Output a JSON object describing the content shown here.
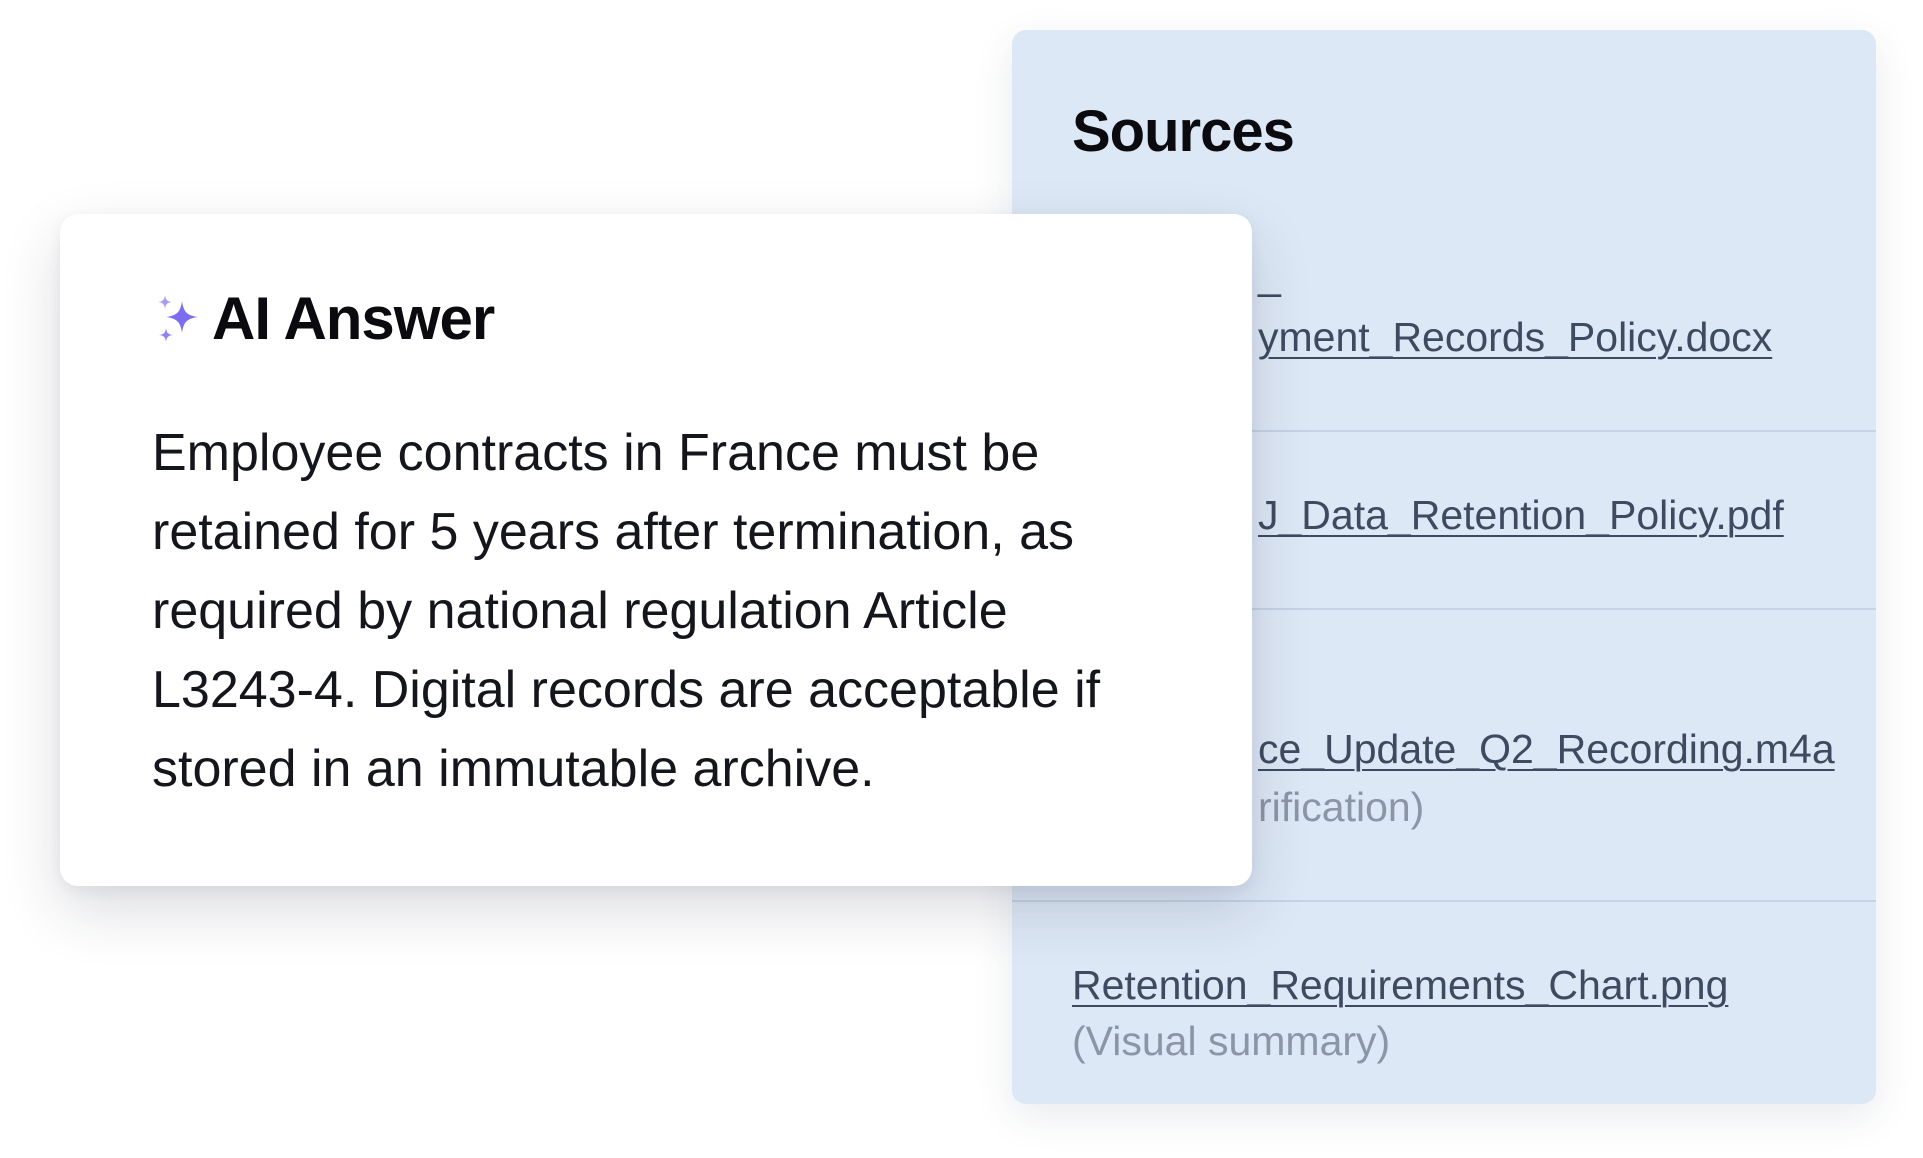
{
  "sources": {
    "title": "Sources",
    "items": [
      {
        "dash": "_",
        "link": "yment_Records_Policy.docx",
        "note": ""
      },
      {
        "link": "J_Data_Retention_Policy.pdf",
        "note": ""
      },
      {
        "link": "ce_Update_Q2_Recording.m4a",
        "note": "rification)"
      },
      {
        "link": "Retention_Requirements_Chart.png",
        "note": "(Visual summary)"
      }
    ]
  },
  "answer": {
    "icon": "sparkle-icon",
    "title": "AI Answer",
    "body": "Employee contracts in France must be\nretained for 5 years after termination, as\nrequired by national regulation Article\nL3243-4. Digital records are  acceptable if\nstored in an immutable archive."
  },
  "colors": {
    "panel_bg": "#dde8f6",
    "sparkle": "#7b6cf0",
    "link": "#3e4a60",
    "note": "#8b95a5"
  }
}
